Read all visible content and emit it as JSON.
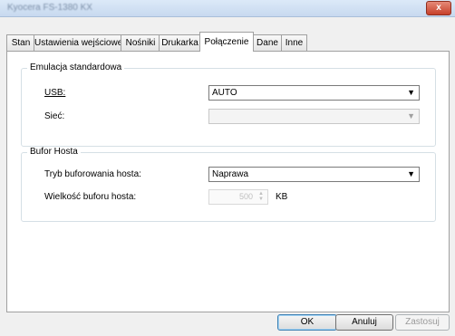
{
  "window": {
    "title": "Kyocera FS-1380 KX",
    "close_label": "x"
  },
  "tabs": [
    {
      "label": "Stan"
    },
    {
      "label": "Ustawienia wejściowe"
    },
    {
      "label": "Nośniki"
    },
    {
      "label": "Drukarka"
    },
    {
      "label": "Połączenie",
      "active": true
    },
    {
      "label": "Dane"
    },
    {
      "label": "Inne"
    }
  ],
  "emulation": {
    "title": "Emulacja standardowa",
    "usb_label": "USB:",
    "usb_value": "AUTO",
    "network_label": "Sieć:",
    "network_value": ""
  },
  "buffer": {
    "title": "Bufor Hosta",
    "mode_label": "Tryb buforowania hosta:",
    "mode_value": "Naprawa",
    "size_label": "Wielkość buforu hosta:",
    "size_value": "500",
    "size_unit": "KB"
  },
  "buttons": {
    "ok": "OK",
    "cancel": "Anuluj",
    "apply": "Zastosuj"
  }
}
